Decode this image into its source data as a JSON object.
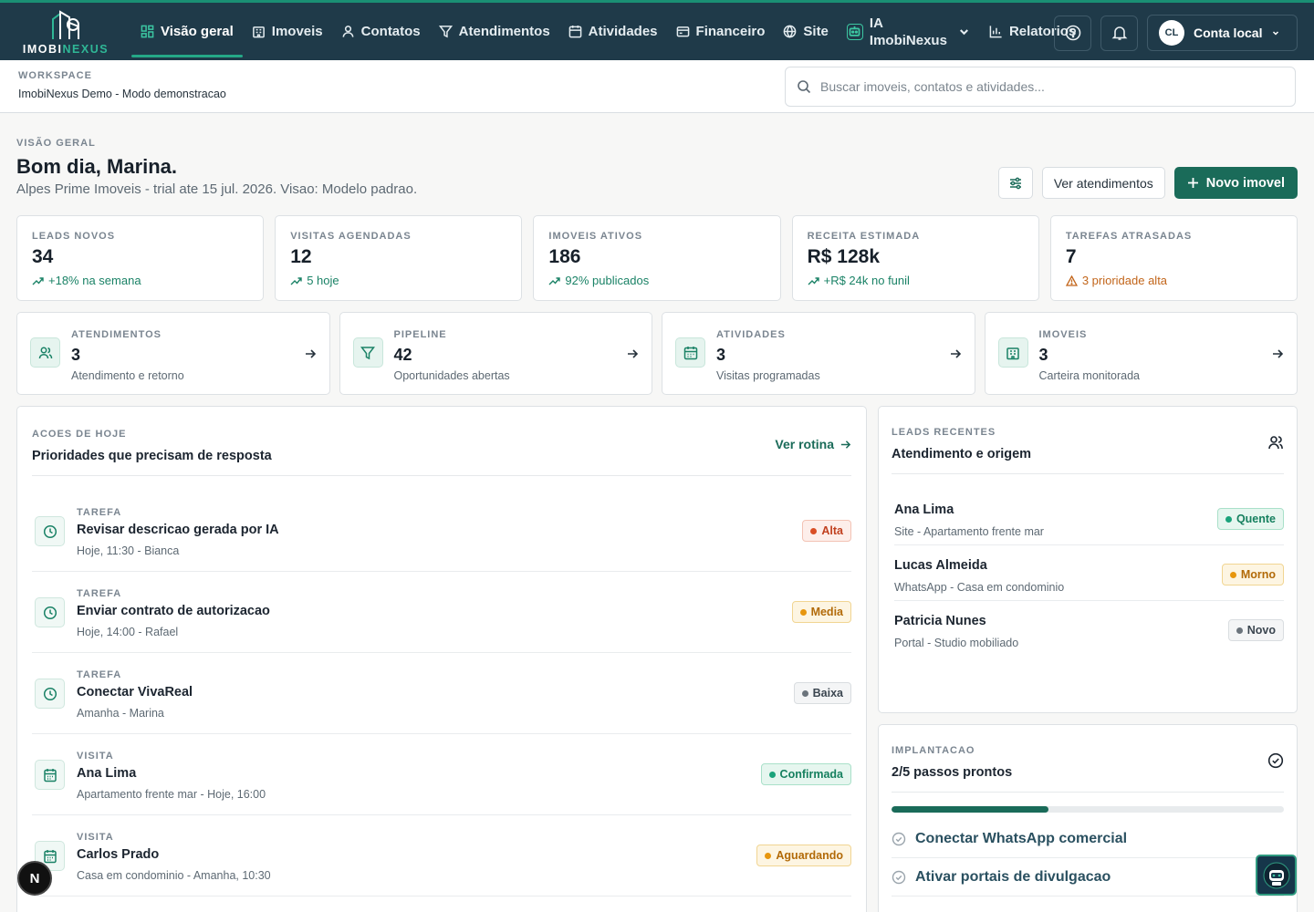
{
  "brand": {
    "name_part1": "IMOBI",
    "name_part2": "NEXUS",
    "accent": "#2fb796",
    "primary": "#1a6b59"
  },
  "nav": {
    "items": [
      {
        "label": "Visão geral",
        "icon": "dashboard-grid-icon"
      },
      {
        "label": "Imoveis",
        "icon": "building-icon"
      },
      {
        "label": "Contatos",
        "icon": "user-icon"
      },
      {
        "label": "Atendimentos",
        "icon": "filter-icon"
      },
      {
        "label": "Atividades",
        "icon": "calendar-icon"
      },
      {
        "label": "Financeiro",
        "icon": "wallet-icon"
      },
      {
        "label": "Site",
        "icon": "globe-icon"
      },
      {
        "label_line1": "IA",
        "label_line2": "ImobiNexus",
        "icon": "robot-icon"
      },
      {
        "label": "Relatorios",
        "icon": "bar-chart-icon"
      }
    ],
    "account": {
      "initials": "CL",
      "label": "Conta local"
    }
  },
  "workspace": {
    "label": "WORKSPACE",
    "value": "ImobiNexus Demo - Modo demonstracao"
  },
  "search": {
    "placeholder": "Buscar imoveis, contatos e atividades..."
  },
  "header": {
    "overline": "VISÃO GERAL",
    "title": "Bom dia, Marina.",
    "subtitle": "Alpes Prime Imoveis - trial ate 15 jul. 2026. Visao: Modelo padrao.",
    "secondary_button": "Ver atendimentos",
    "primary_button": "Novo imovel"
  },
  "kpis": [
    {
      "label": "LEADS NOVOS",
      "value": "34",
      "delta": "+18% na semana",
      "tone": "up"
    },
    {
      "label": "VISITAS AGENDADAS",
      "value": "12",
      "delta": "5 hoje",
      "tone": "up"
    },
    {
      "label": "IMOVEIS ATIVOS",
      "value": "186",
      "delta": "92% publicados",
      "tone": "up"
    },
    {
      "label": "RECEITA ESTIMADA",
      "value": "R$ 128k",
      "delta": "+R$ 24k no funil",
      "tone": "up"
    },
    {
      "label": "TAREFAS ATRASADAS",
      "value": "7",
      "delta": "3 prioridade alta",
      "tone": "warn"
    }
  ],
  "shortcuts": [
    {
      "label": "ATENDIMENTOS",
      "value": "3",
      "desc": "Atendimento e retorno",
      "icon": "users-icon"
    },
    {
      "label": "PIPELINE",
      "value": "42",
      "desc": "Oportunidades abertas",
      "icon": "filter-icon"
    },
    {
      "label": "ATIVIDADES",
      "value": "3",
      "desc": "Visitas programadas",
      "icon": "calendar-icon"
    },
    {
      "label": "IMOVEIS",
      "value": "3",
      "desc": "Carteira monitorada",
      "icon": "building-icon"
    }
  ],
  "actions_panel": {
    "overline": "ACOES DE HOJE",
    "title": "Prioridades que precisam de resposta",
    "link": "Ver rotina",
    "items": [
      {
        "type": "TAREFA",
        "title": "Revisar descricao gerada por IA",
        "meta": "Hoje, 11:30 - Bianca",
        "badge": "Alta",
        "tone": "red",
        "icon": "clock-icon"
      },
      {
        "type": "TAREFA",
        "title": "Enviar contrato de autorizacao",
        "meta": "Hoje, 14:00 - Rafael",
        "badge": "Media",
        "tone": "amber",
        "icon": "clock-icon"
      },
      {
        "type": "TAREFA",
        "title": "Conectar VivaReal",
        "meta": "Amanha - Marina",
        "badge": "Baixa",
        "tone": "gray",
        "icon": "clock-icon"
      },
      {
        "type": "VISITA",
        "title": "Ana Lima",
        "meta": "Apartamento frente mar - Hoje, 16:00",
        "badge": "Confirmada",
        "tone": "green",
        "icon": "calendar-icon"
      },
      {
        "type": "VISITA",
        "title": "Carlos Prado",
        "meta": "Casa em condominio - Amanha, 10:30",
        "badge": "Aguardando",
        "tone": "amber",
        "icon": "calendar-icon"
      }
    ]
  },
  "leads_panel": {
    "overline": "LEADS RECENTES",
    "title": "Atendimento e origem",
    "items": [
      {
        "name": "Ana Lima",
        "meta": "Site - Apartamento frente mar",
        "badge": "Quente",
        "tone": "green"
      },
      {
        "name": "Lucas Almeida",
        "meta": "WhatsApp - Casa em condominio",
        "badge": "Morno",
        "tone": "amber"
      },
      {
        "name": "Patricia Nunes",
        "meta": "Portal - Studio mobiliado",
        "badge": "Novo",
        "tone": "gray"
      }
    ]
  },
  "impl_panel": {
    "overline": "IMPLANTACAO",
    "title": "2/5 passos prontos",
    "progress": 0.4,
    "steps": [
      {
        "label": "Conectar WhatsApp comercial"
      },
      {
        "label": "Ativar portais de divulgacao"
      }
    ]
  },
  "fab": {
    "n_label": "N"
  }
}
